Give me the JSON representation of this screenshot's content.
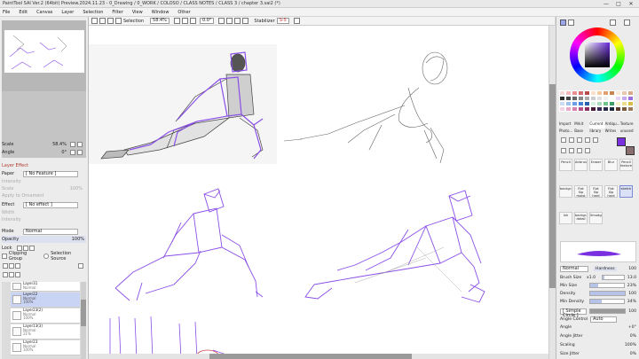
{
  "window": {
    "title": "PaintTool SAI Ver.2 (64bit) Preview.2024.11.23 - 0_Drawing / 0_WORK / COLOSO / CLASS NOTES / CLASS 3 / chapter 3.sai2 (*)",
    "controls": [
      "—",
      "□",
      "✕"
    ]
  },
  "menu": [
    "File",
    "Edit",
    "Canvas",
    "Layer",
    "Selection",
    "Filter",
    "View",
    "Window",
    "Other"
  ],
  "toolbar": {
    "selection_label": "Selection",
    "zoom": "58.4%",
    "rotation": "0.0°",
    "stabilizer_label": "Stabilizer",
    "stabilizer_value": "S-5"
  },
  "navigator": {
    "scale_label": "Scale",
    "scale_value": "58.4%",
    "angle_label": "Angle",
    "angle_value": "0°"
  },
  "layer_effect": {
    "header": "Layer Effect",
    "paper_label": "Paper",
    "paper_value": "[ No Feature ]",
    "intensity_label": "Intensity",
    "scale_label": "Scale",
    "scale_value": "100%",
    "apply_label": "Apply to Ornament",
    "effect_label": "Effect",
    "effect_value": "[ No effect ]",
    "width_label": "Width",
    "effect_intensity_label": "Intensity"
  },
  "layer_props": {
    "mode_label": "Mode",
    "mode_value": "Normal",
    "opacity_label": "Opacity",
    "opacity_value": "100%",
    "lock_label": "Lock",
    "clipping_label": "Clipping Group",
    "selection_source_label": "Selection Source"
  },
  "layers": [
    {
      "name": "Layer31",
      "mode": "Normal",
      "opacity": "100%",
      "selected": false
    },
    {
      "name": "Layer22",
      "mode": "Normal",
      "opacity": "100%",
      "selected": true
    },
    {
      "name": "Layer23(2)",
      "mode": "Normal",
      "opacity": "100%",
      "selected": false
    },
    {
      "name": "Layer13(3)",
      "mode": "Normal",
      "opacity": "21%",
      "selected": false
    },
    {
      "name": "Layer23",
      "mode": "Normal",
      "opacity": "100%",
      "selected": false
    }
  ],
  "tools_tabs": [
    "Import",
    "Mrkit",
    "Current",
    "Antiqu...",
    "Texture"
  ],
  "tools_tabs2": [
    "Photo...",
    "Base",
    "library",
    "Writes",
    "unused"
  ],
  "brushes": [
    {
      "label": "Pencil",
      "selected": false
    },
    {
      "label": "Airbrush",
      "selected": false
    },
    {
      "label": "Eraser",
      "selected": false
    },
    {
      "label": "Blur",
      "selected": false
    },
    {
      "label": "Pencil texture",
      "selected": false
    },
    {
      "label": "backgr...",
      "selected": false
    },
    {
      "label": "Flat Sip moist",
      "selected": false
    },
    {
      "label": "Flat Sip hard",
      "selected": false
    },
    {
      "label": "Flat Sip hard",
      "selected": false
    },
    {
      "label": "sketch",
      "selected": true
    },
    {
      "label": "Ink",
      "selected": false
    },
    {
      "label": "backgr... detail",
      "selected": false
    },
    {
      "label": "Smudge",
      "selected": false
    }
  ],
  "brush_props": {
    "mode": "Normal",
    "hardness_label": "Hardness",
    "hardness_value": "100",
    "brush_size_label": "Brush Size",
    "brush_size_mult": "x1.0",
    "brush_size_value": "13.0",
    "min_size_label": "Min Size",
    "min_size_value": "23%",
    "min_size_fraction": 0.23,
    "density_label": "Density",
    "density_value": "100",
    "density_fraction": 1.0,
    "min_density_label": "Min Density",
    "min_density_value": "34%",
    "min_density_fraction": 0.34,
    "shape_label": "[ Simple Circle ]",
    "shape_value": "100",
    "angle_control_label": "Angle Control",
    "angle_control_value": "Auto",
    "angle_label": "Angle",
    "angle_value": "+0°",
    "angle_jitter_label": "Angle Jitter",
    "angle_jitter_value": "0%",
    "scaling_label": "Scaling",
    "scaling_value": "100%",
    "size_jitter_label": "Size Jitter",
    "size_jitter_value": "0%"
  },
  "colors": {
    "primary": "#7a2fe0",
    "sketch_stroke": "#8a4fe8",
    "pencil_stroke": "#555555",
    "accent_red": "#b03a2e",
    "swatches": [
      "#f2d6d6",
      "#f4b8b8",
      "#e99090",
      "#d46a6a",
      "#b84c4c",
      "#f8e1c8",
      "#f5c89e",
      "#e2a070",
      "#c98550",
      "#fbe9d9",
      "#eac8b0",
      "#d9a888",
      "#2b2b2b",
      "#444444",
      "#666666",
      "#888888",
      "#aaaaaa",
      "#cccccc",
      "#e0e0e0",
      "#f0f0f0",
      "#ffffff",
      "#e7d4f7",
      "#c9a9ef",
      "#9c6fe0",
      "#c8dcf5",
      "#9ec1ee",
      "#6b9ee6",
      "#3f7dd6",
      "#2a5fae",
      "#d6f0e0",
      "#a8dcb9",
      "#6fc48e",
      "#3c9e64",
      "#f7f1c9",
      "#eedd8c",
      "#d9be4a",
      "#f3d1e4",
      "#e8a9cb",
      "#d77fae",
      "#b94f88",
      "#8a2e62",
      "#4a1a3a",
      "#3a2a5a",
      "#2a2a4a",
      "#1a2a3a",
      "#5a3a2a",
      "#7a5a3a",
      "#9a7a5a"
    ]
  }
}
